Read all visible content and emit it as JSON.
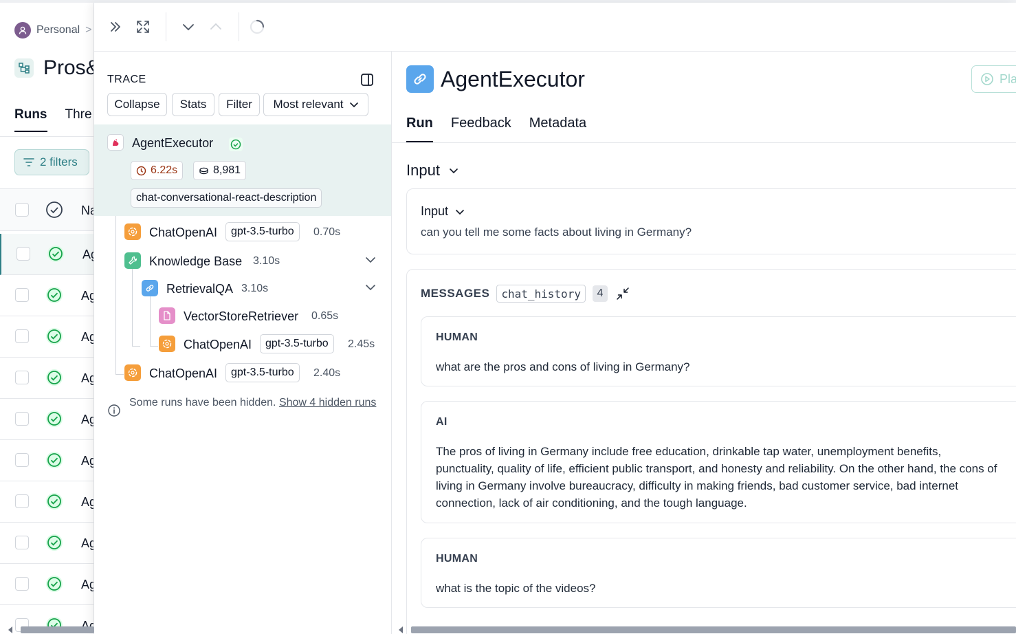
{
  "background": {
    "breadcrumb": "Personal",
    "breadcrumb_sep": ">",
    "project_title": "Pros&",
    "tabs": [
      "Runs",
      "Thre"
    ],
    "filters_label": "2 filters",
    "column_name": "Na",
    "row_name": "Ag"
  },
  "trace": {
    "label": "TRACE",
    "buttons": {
      "collapse": "Collapse",
      "stats": "Stats",
      "filter": "Filter",
      "sort": "Most relevant"
    },
    "root": {
      "name": "AgentExecutor",
      "latency": "6.22s",
      "tokens": "8,981",
      "tag": "chat-conversational-react-description"
    },
    "nodes": [
      {
        "name": "ChatOpenAI",
        "model": "gpt-3.5-turbo",
        "time": "0.70s"
      },
      {
        "name": "Knowledge Base",
        "time": "3.10s"
      },
      {
        "name": "RetrievalQA",
        "time": "3.10s"
      },
      {
        "name": "VectorStoreRetriever",
        "time": "0.65s"
      },
      {
        "name": "ChatOpenAI",
        "model": "gpt-3.5-turbo",
        "time": "2.45s"
      },
      {
        "name": "ChatOpenAI",
        "model": "gpt-3.5-turbo",
        "time": "2.40s"
      }
    ],
    "hidden_note": "Some runs have been hidden.",
    "hidden_link": "Show 4 hidden runs"
  },
  "detail": {
    "title": "AgentExecutor",
    "play_label": "Pla",
    "tabs": [
      "Run",
      "Feedback",
      "Metadata"
    ],
    "section_title": "Input",
    "input": {
      "label": "Input",
      "value": "can you tell me some facts about living in Germany?"
    },
    "messages": {
      "label": "MESSAGES",
      "key": "chat_history",
      "count": "4",
      "items": [
        {
          "role": "HUMAN",
          "text": "what are the pros and cons of living in Germany?"
        },
        {
          "role": "AI",
          "text": "The pros of living in Germany include free education, drinkable tap water, unemployment benefits, punctuality, quality of life, efficient public transport, and honesty and reliability. On the other hand, the cons of living in Germany involve bureaucracy, difficulty in making friends, bad customer service, bad internet connection, lack of air conditioning, and the tough language."
        },
        {
          "role": "HUMAN",
          "text": "what is the topic of the videos?"
        }
      ]
    }
  },
  "colors": {
    "accent_teal": "#2e7f86",
    "selected_row": "#e8f2f1",
    "openai_orange": "#f59e3b",
    "tool_green": "#4fbf8f",
    "chain_blue": "#5aa6ec",
    "retriever_pink": "#e58fc9",
    "success_green": "#16a34a"
  }
}
